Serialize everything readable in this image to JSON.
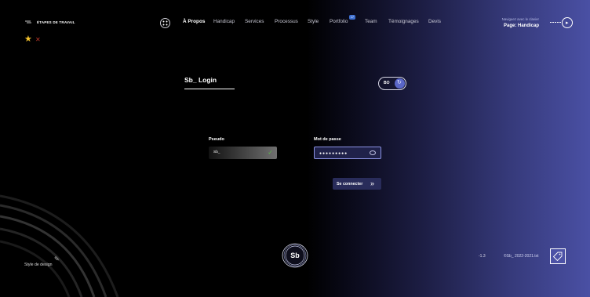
{
  "header": {
    "steps_label": "ÉTAPES DE TRAVAIL",
    "nav": [
      {
        "label": "À Propos",
        "active": true
      },
      {
        "label": "Handicap"
      },
      {
        "label": "Services"
      },
      {
        "label": "Processus"
      },
      {
        "label": "Style"
      },
      {
        "label": "Portfolio"
      },
      {
        "label": "Team"
      },
      {
        "label": "Témoignages"
      },
      {
        "label": "Devis"
      }
    ],
    "portfolio_badge": "17",
    "nav_hint": "Naviguez avec le clavier",
    "page_label": "Page: Handicap"
  },
  "login": {
    "title": "Sb_ Login",
    "toggle_label": "BO",
    "pseudo_label": "Pseudo",
    "pseudo_value": "Sb_",
    "password_label": "Mot de passe",
    "password_value": "●●●●●●●●●",
    "submit_label": "Se connecter"
  },
  "footer": {
    "design_label": "Style de design",
    "logo_text": "Sb",
    "version": "-1.3",
    "copyright": "©Sb_ 2022-2021.txt"
  },
  "colors": {
    "accent": "#4d53a6",
    "star": "#f6c42d",
    "check": "#5ab84a",
    "close": "#c0392b"
  },
  "icons": [
    "menu-lines-icon",
    "star-icon",
    "close-icon",
    "grid-icon",
    "play-icon",
    "rotate-icon",
    "check-icon",
    "eye-icon",
    "double-arrow-icon",
    "brush-icon",
    "tag-icon"
  ]
}
